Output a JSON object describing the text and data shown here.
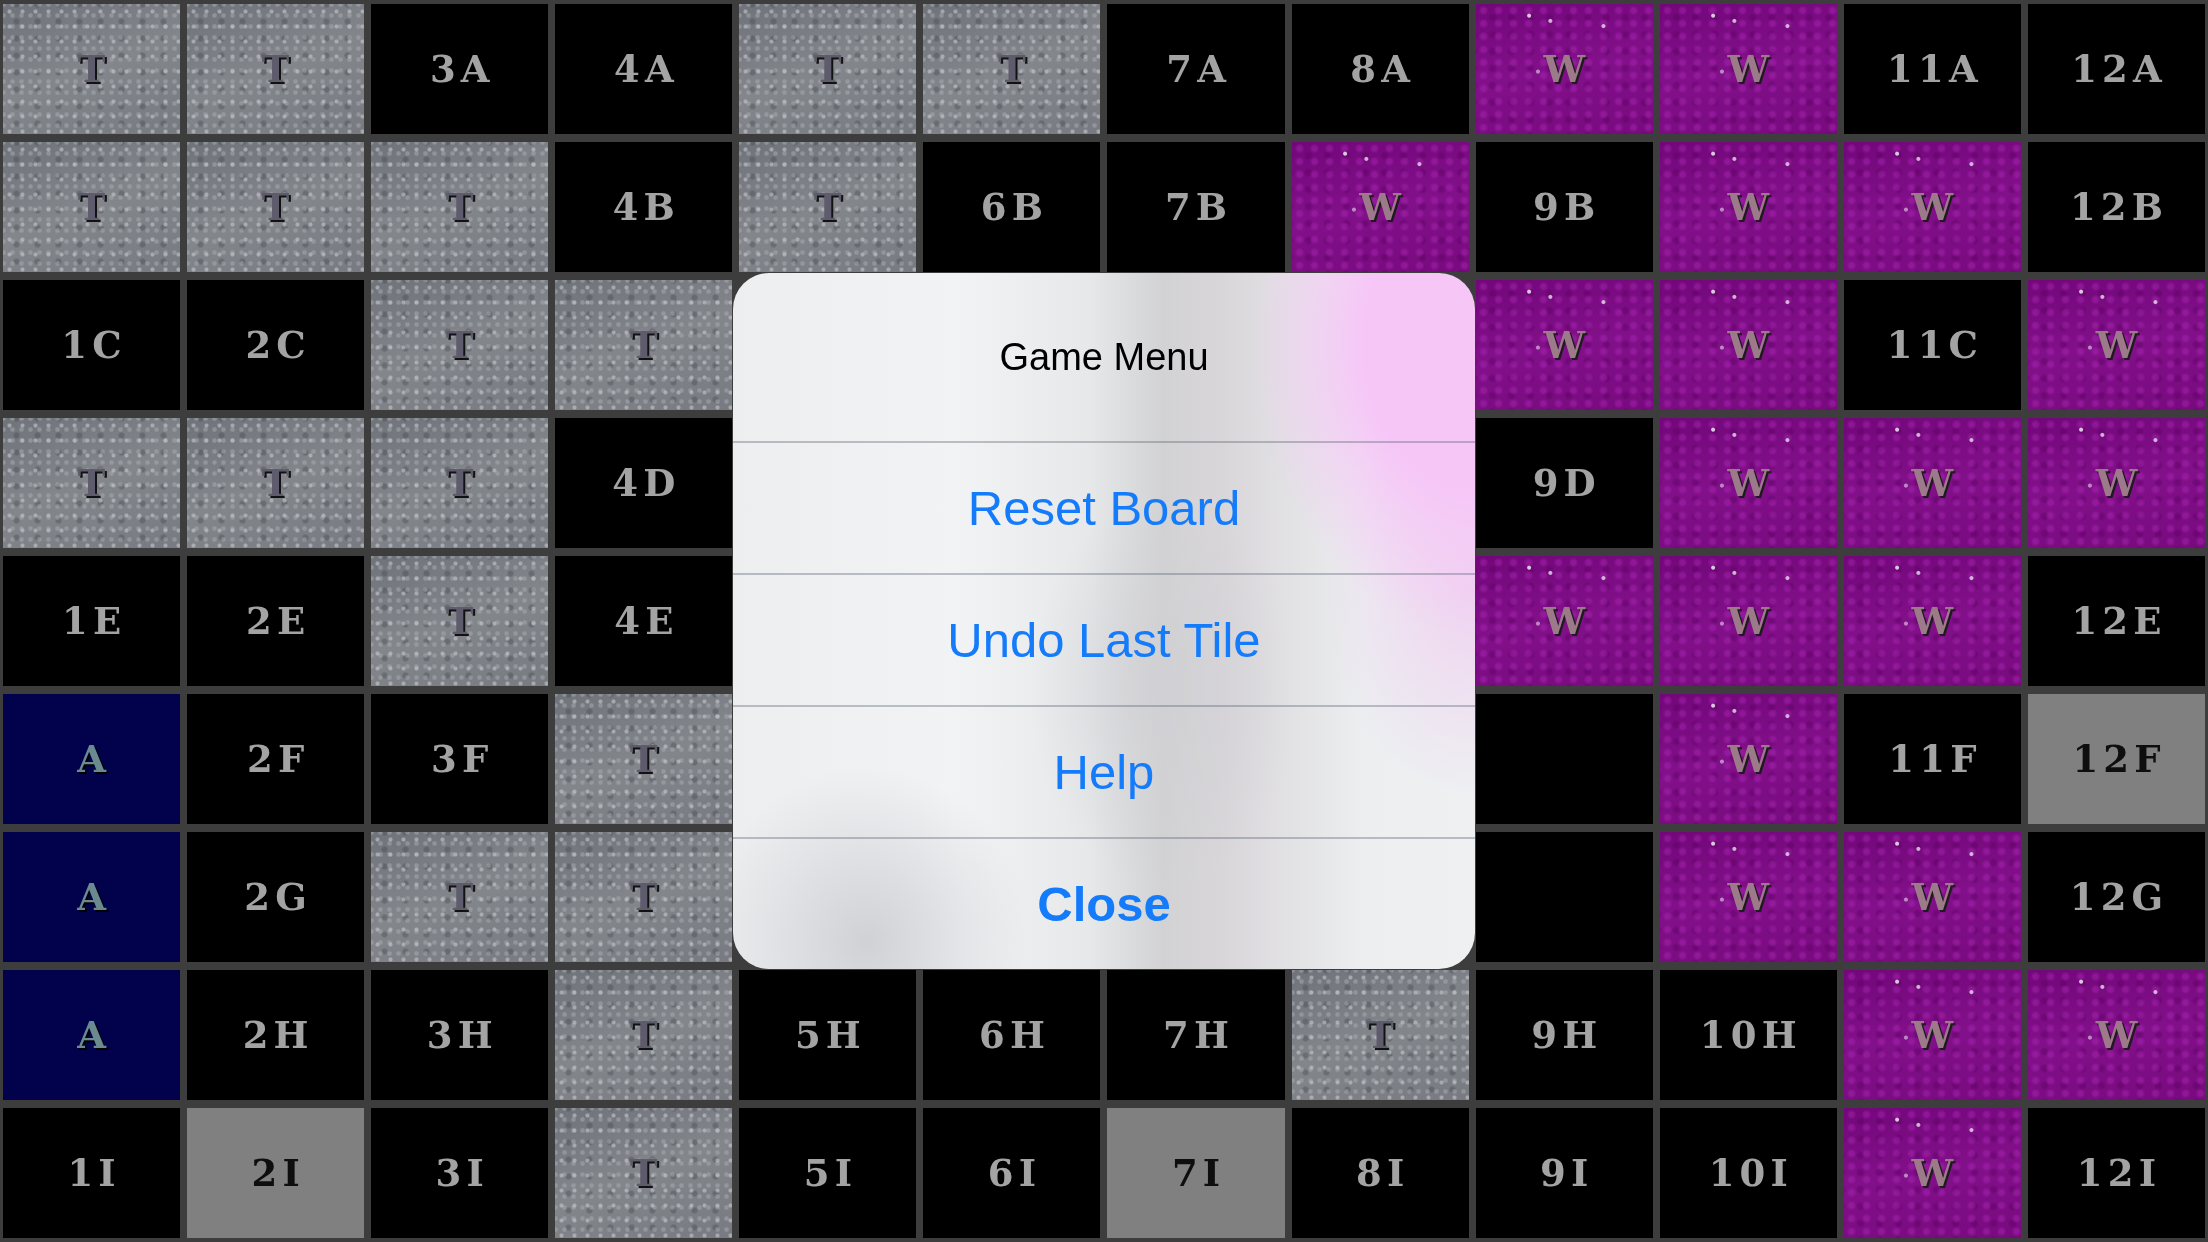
{
  "board": {
    "rows": [
      {
        "cells": [
          {
            "kind": "stone",
            "label": "T"
          },
          {
            "kind": "stone",
            "label": "T"
          },
          {
            "kind": "open",
            "label": "3A"
          },
          {
            "kind": "open",
            "label": "4A"
          },
          {
            "kind": "stone",
            "label": "T"
          },
          {
            "kind": "stone",
            "label": "T"
          },
          {
            "kind": "open",
            "label": "7A"
          },
          {
            "kind": "open",
            "label": "8A"
          },
          {
            "kind": "water",
            "label": "W"
          },
          {
            "kind": "water",
            "label": "W"
          },
          {
            "kind": "open",
            "label": "11A"
          },
          {
            "kind": "open",
            "label": "12A"
          }
        ]
      },
      {
        "cells": [
          {
            "kind": "stone",
            "label": "T"
          },
          {
            "kind": "stone",
            "label": "T"
          },
          {
            "kind": "stone",
            "label": "T"
          },
          {
            "kind": "open",
            "label": "4B"
          },
          {
            "kind": "stone",
            "label": "T"
          },
          {
            "kind": "open",
            "label": "6B"
          },
          {
            "kind": "open",
            "label": "7B"
          },
          {
            "kind": "water",
            "label": "W"
          },
          {
            "kind": "open",
            "label": "9B"
          },
          {
            "kind": "water",
            "label": "W"
          },
          {
            "kind": "water",
            "label": "W"
          },
          {
            "kind": "open",
            "label": "12B"
          }
        ]
      },
      {
        "cells": [
          {
            "kind": "open",
            "label": "1C"
          },
          {
            "kind": "open",
            "label": "2C"
          },
          {
            "kind": "stone",
            "label": "T"
          },
          {
            "kind": "stone",
            "label": "T"
          },
          {
            "kind": "water",
            "label": "W"
          },
          {
            "kind": "water",
            "label": "W"
          },
          {
            "kind": "open",
            "label": "11C"
          },
          {
            "kind": "water",
            "label": "W"
          }
        ]
      },
      {
        "cells": [
          {
            "kind": "stone",
            "label": "T"
          },
          {
            "kind": "stone",
            "label": "T"
          },
          {
            "kind": "stone",
            "label": "T"
          },
          {
            "kind": "open",
            "label": "4D"
          },
          {
            "kind": "open",
            "label": "9D"
          },
          {
            "kind": "water",
            "label": "W"
          },
          {
            "kind": "water",
            "label": "W"
          },
          {
            "kind": "water",
            "label": "W"
          }
        ]
      },
      {
        "cells": [
          {
            "kind": "open",
            "label": "1E"
          },
          {
            "kind": "open",
            "label": "2E"
          },
          {
            "kind": "stone",
            "label": "T"
          },
          {
            "kind": "open",
            "label": "4E"
          },
          {
            "kind": "water",
            "label": "W"
          },
          {
            "kind": "water",
            "label": "W"
          },
          {
            "kind": "water",
            "label": "W"
          },
          {
            "kind": "open",
            "label": "12E"
          }
        ]
      },
      {
        "cells": [
          {
            "kind": "deep",
            "label": "A"
          },
          {
            "kind": "open",
            "label": "2F"
          },
          {
            "kind": "open",
            "label": "3F"
          },
          {
            "kind": "stone",
            "label": "T"
          },
          {
            "kind": "blank"
          },
          {
            "kind": "water",
            "label": "W"
          },
          {
            "kind": "open",
            "label": "11F"
          },
          {
            "kind": "marked",
            "label": "12F"
          }
        ]
      },
      {
        "cells": [
          {
            "kind": "deep",
            "label": "A"
          },
          {
            "kind": "open",
            "label": "2G"
          },
          {
            "kind": "stone",
            "label": "T"
          },
          {
            "kind": "stone",
            "label": "T"
          },
          {
            "kind": "blank"
          },
          {
            "kind": "water",
            "label": "W"
          },
          {
            "kind": "water",
            "label": "W"
          },
          {
            "kind": "open",
            "label": "12G"
          }
        ]
      },
      {
        "cells": [
          {
            "kind": "deep",
            "label": "A"
          },
          {
            "kind": "open",
            "label": "2H"
          },
          {
            "kind": "open",
            "label": "3H"
          },
          {
            "kind": "stone",
            "label": "T"
          },
          {
            "kind": "open",
            "label": "5H"
          },
          {
            "kind": "open",
            "label": "6H"
          },
          {
            "kind": "open",
            "label": "7H"
          },
          {
            "kind": "stone",
            "label": "T"
          },
          {
            "kind": "open",
            "label": "9H"
          },
          {
            "kind": "open",
            "label": "10H"
          },
          {
            "kind": "water",
            "label": "W"
          },
          {
            "kind": "water",
            "label": "W"
          }
        ]
      },
      {
        "cells": [
          {
            "kind": "open",
            "label": "1I"
          },
          {
            "kind": "marked",
            "label": "2I"
          },
          {
            "kind": "open",
            "label": "3I"
          },
          {
            "kind": "stone",
            "label": "T"
          },
          {
            "kind": "open",
            "label": "5I"
          },
          {
            "kind": "open",
            "label": "6I"
          },
          {
            "kind": "marked",
            "label": "7I"
          },
          {
            "kind": "open",
            "label": "8I"
          },
          {
            "kind": "open",
            "label": "9I"
          },
          {
            "kind": "open",
            "label": "10I"
          },
          {
            "kind": "water",
            "label": "W"
          },
          {
            "kind": "open",
            "label": "12I"
          }
        ]
      }
    ]
  },
  "dialog": {
    "title": "Game Menu",
    "buttons": [
      {
        "label": "Reset Board",
        "kind": "default"
      },
      {
        "label": "Undo Last Tile",
        "kind": "default"
      },
      {
        "label": "Help",
        "kind": "default"
      },
      {
        "label": "Close",
        "kind": "cancel"
      }
    ]
  }
}
